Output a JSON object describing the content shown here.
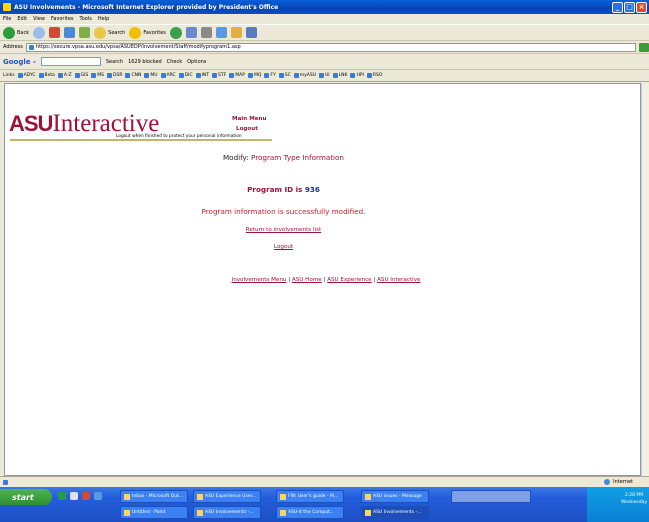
{
  "window": {
    "title": "ASU Involvements - Microsoft Internet Explorer provided by President's Office"
  },
  "menu": [
    "File",
    "Edit",
    "View",
    "Favorites",
    "Tools",
    "Help"
  ],
  "toolbar": {
    "back": "Back",
    "search": "Search",
    "favorites": "Favorites"
  },
  "address": {
    "label": "Address",
    "url": "https://secure.vpsa.asu.edu/vpsa/ASUEDP/Involvement/Staff/modifyprogram1.asp"
  },
  "google": {
    "logo": "Google -",
    "search": "Search",
    "blocked": "1629 blocked",
    "check": "Check",
    "options": "Options"
  },
  "links": {
    "label": "Links",
    "items": [
      "ADYC",
      "Beta",
      "A-Z",
      "GIS",
      "MS",
      "DSR",
      "CNN",
      "MU",
      "ARC",
      "DIC",
      "INT",
      "STF",
      "MAP",
      "MQ",
      "FY",
      "SC",
      "myASU",
      "UI",
      "LNK",
      "HPI",
      "RSO"
    ]
  },
  "page": {
    "logo_asu": "ASU",
    "logo_interactive": "Interactive",
    "logout_note": "Logout when finished to protect your personal information",
    "main_menu": "Main Menu",
    "logout_top": "Logout",
    "modify_prefix": "Modify: ",
    "modify_highlight": "Program Type Information",
    "program_id_prefix": "Program ID is ",
    "program_id": "936",
    "success": "Program information is successfully modified.",
    "return_link": "Return to involvements list",
    "logout_link": "Logout",
    "footer": [
      "Involvements Menu",
      "ASU Home",
      "ASU Experience",
      "ASU Interactive"
    ],
    "footer_sep": " | "
  },
  "status": {
    "zone": "Internet"
  },
  "taskbar": {
    "start": "start",
    "tasks_row1": [
      "Inbox - Microsoft Out...",
      "ASU Experience User...",
      "FW: User's guide - M...",
      "ASU issues - Message"
    ],
    "tasks_row2": [
      "Untitled - Paint",
      "ASU Involvements -...",
      "ASU-it the Comput...",
      "ASU Involvements -..."
    ],
    "clock": "2:28 PM",
    "day": "Wednesday"
  }
}
